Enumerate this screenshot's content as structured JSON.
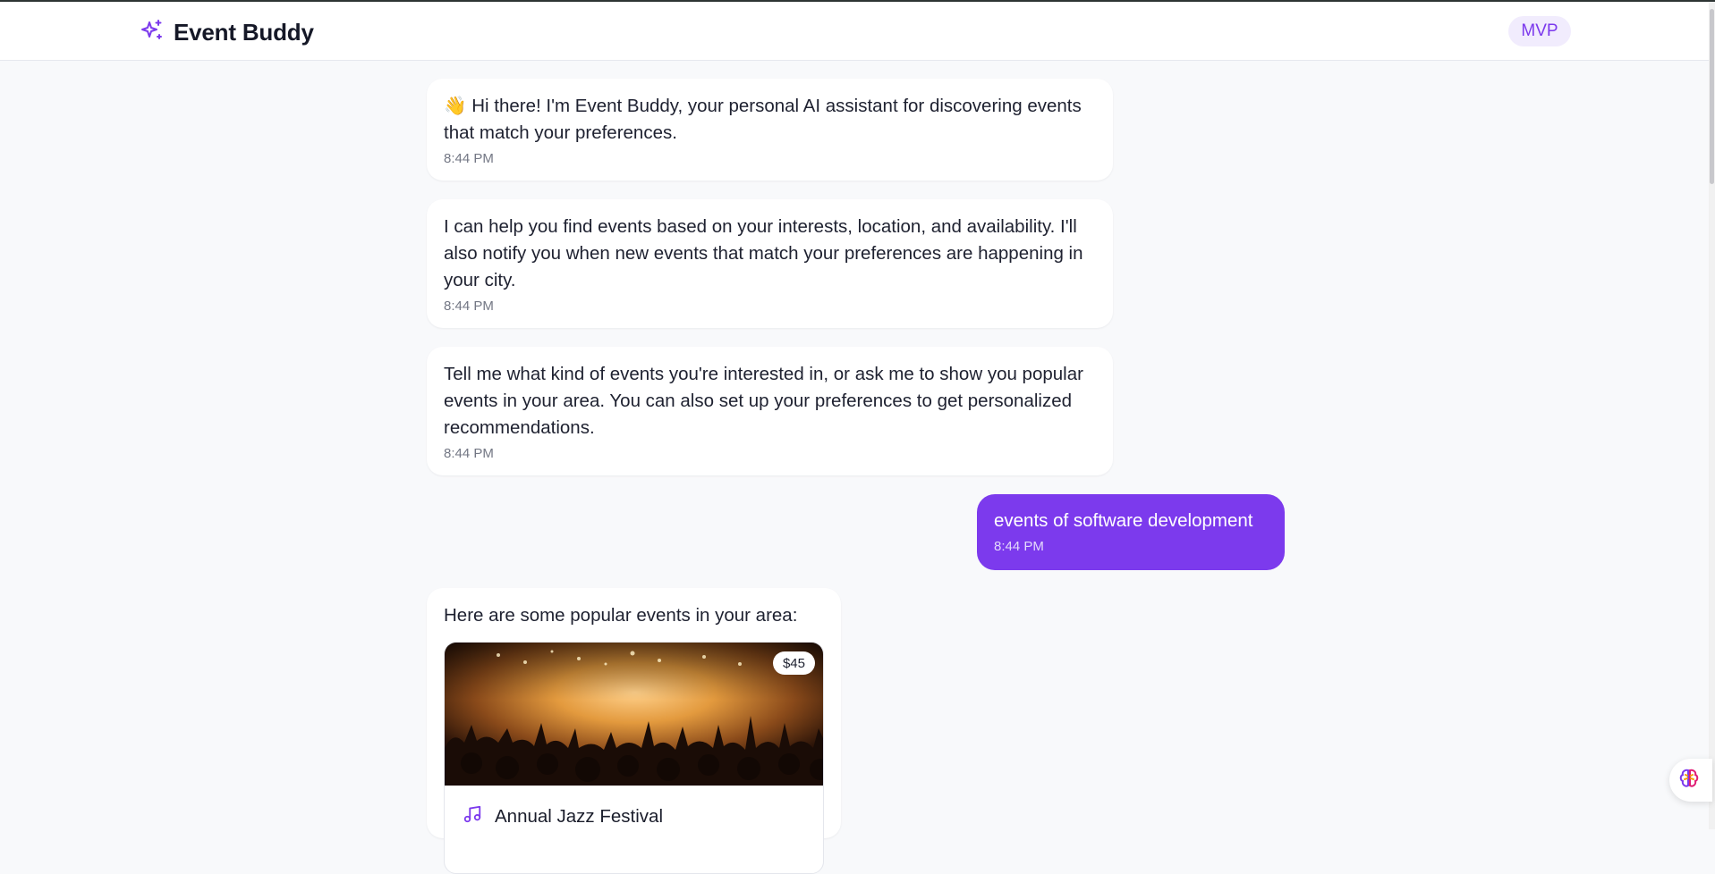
{
  "header": {
    "title": "Event Buddy",
    "badge": "MVP",
    "logo_icon": "sparkles-icon"
  },
  "messages": [
    {
      "sender": "bot",
      "emoji": "👋",
      "text": "Hi there! I'm Event Buddy, your personal AI assistant for discovering events that match your preferences.",
      "time": "8:44 PM"
    },
    {
      "sender": "bot",
      "text": "I can help you find events based on your interests, location, and availability. I'll also notify you when new events that match your preferences are happening in your city.",
      "time": "8:44 PM"
    },
    {
      "sender": "bot",
      "text": "Tell me what kind of events you're interested in, or ask me to show you popular events in your area. You can also set up your preferences to get personalized recommendations.",
      "time": "8:44 PM"
    },
    {
      "sender": "user",
      "text": "events of software development",
      "time": "8:44 PM"
    },
    {
      "sender": "bot",
      "text": "Here are some popular events in your area:"
    }
  ],
  "events": [
    {
      "title": "Annual Jazz Festival",
      "price": "$45",
      "category_icon": "music-note-icon"
    }
  ],
  "floating_button": {
    "icon": "brain-icon"
  },
  "colors": {
    "accent": "#7c3aed",
    "background": "#f8f9fb",
    "bubble": "#ffffff"
  }
}
